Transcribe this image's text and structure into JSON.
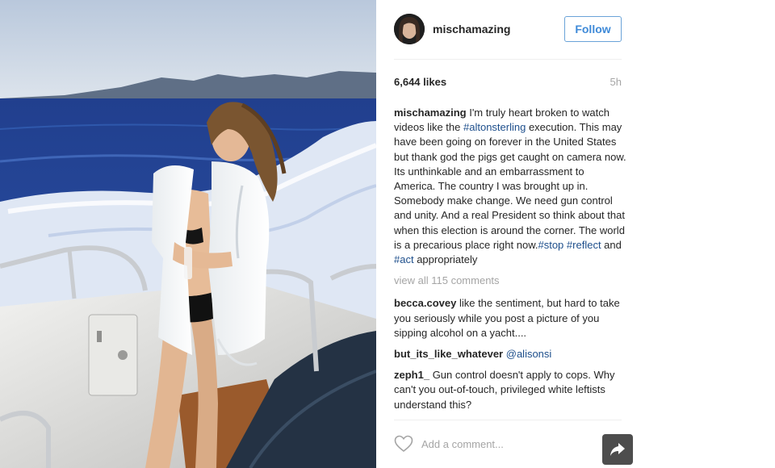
{
  "post": {
    "username": "mischamazing",
    "follow_label": "Follow",
    "likes": "6,644 likes",
    "time": "5h",
    "caption": {
      "user": "mischamazing",
      "text_1": " I'm truly heart broken to watch videos like the ",
      "tag_1": "#altonsterling",
      "text_2": " execution. This may have been going on forever in the United States but thank god the pigs get caught on camera now. Its unthinkable and an embarrassment to America. The country I was brought up in. Somebody make change. We need gun control and unity. And a real President so think about that when this election is around the corner. The world is a precarious place right now.",
      "tag_2": "#stop",
      "text_3": " ",
      "tag_3": "#reflect",
      "text_4": " and ",
      "tag_4": "#act",
      "text_5": " appropriately"
    },
    "view_all_comments": "view all 115 comments",
    "comments": [
      {
        "user": "becca.covey",
        "text": " like the sentiment, but hard to take you seriously while you post a picture of you sipping alcohol on a yacht...."
      },
      {
        "user": "but_its_like_whatever",
        "text": " ",
        "mention": "@alisonsi"
      },
      {
        "user": "zeph1_",
        "text": " Gun control doesn't apply to cops. Why can't you out-of-touch, privileged white leftists understand this?"
      }
    ],
    "add_comment_placeholder": "Add a comment..."
  },
  "icons": {
    "like": "heart-outline-icon",
    "share": "share-arrow-icon"
  },
  "colors": {
    "follow_border": "#6aa3d8",
    "follow_text": "#3f8ad8",
    "hashtag": "#1e4f8c",
    "muted": "#a5a5a5",
    "share_bg": "#4d4d4d"
  }
}
